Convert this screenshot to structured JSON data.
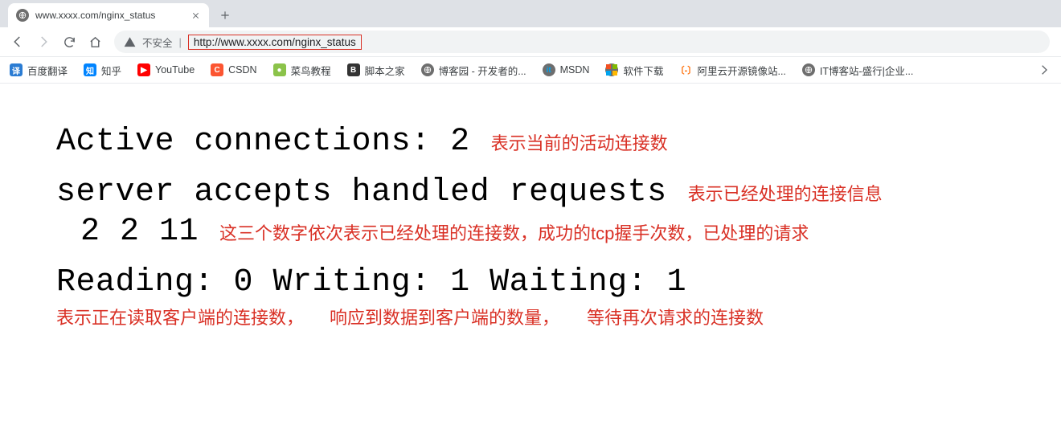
{
  "tab": {
    "title": "www.xxxx.com/nginx_status"
  },
  "toolbar": {
    "insecure_label": "不安全",
    "url": "http://www.xxxx.com/nginx_status"
  },
  "bookmarks": [
    {
      "label": "百度翻译",
      "icon_text": "译",
      "icon_bg": "#2b7cd3"
    },
    {
      "label": "知乎",
      "icon_text": "知",
      "icon_bg": "#0084ff"
    },
    {
      "label": "YouTube",
      "icon_text": "▶",
      "icon_bg": "#ff0000"
    },
    {
      "label": "CSDN",
      "icon_text": "C",
      "icon_bg": "#fc5531"
    },
    {
      "label": "菜鸟教程",
      "icon_text": "●",
      "icon_bg": "#8bc34a"
    },
    {
      "label": "脚本之家",
      "icon_text": "B",
      "icon_bg": "#333333"
    },
    {
      "label": "博客园 - 开发者的...",
      "icon_text": "",
      "icon_bg": ""
    },
    {
      "label": "MSDN",
      "icon_text": "it",
      "icon_bg": ""
    },
    {
      "label": "软件下载",
      "icon_text": "",
      "icon_bg": ""
    },
    {
      "label": "阿里云开源镜像站...",
      "icon_text": "〔-〕",
      "icon_bg": "#ff6a00"
    },
    {
      "label": "IT博客站-盛行|企业...",
      "icon_text": "",
      "icon_bg": ""
    }
  ],
  "status": {
    "line1": "Active connections: 2",
    "ann1": "表示当前的活动连接数",
    "line2": "server accepts handled requests",
    "ann2": "表示已经处理的连接信息",
    "line3": " 2 2 11",
    "ann3": "这三个数字依次表示已经处理的连接数，成功的tcp握手次数，已处理的请求",
    "line4": "Reading: 0 Writing: 1 Waiting: 1",
    "ann4a": "表示正在读取客户端的连接数，",
    "ann4b": "响应到数据到客户端的数量，",
    "ann4c": "等待再次请求的连接数"
  }
}
